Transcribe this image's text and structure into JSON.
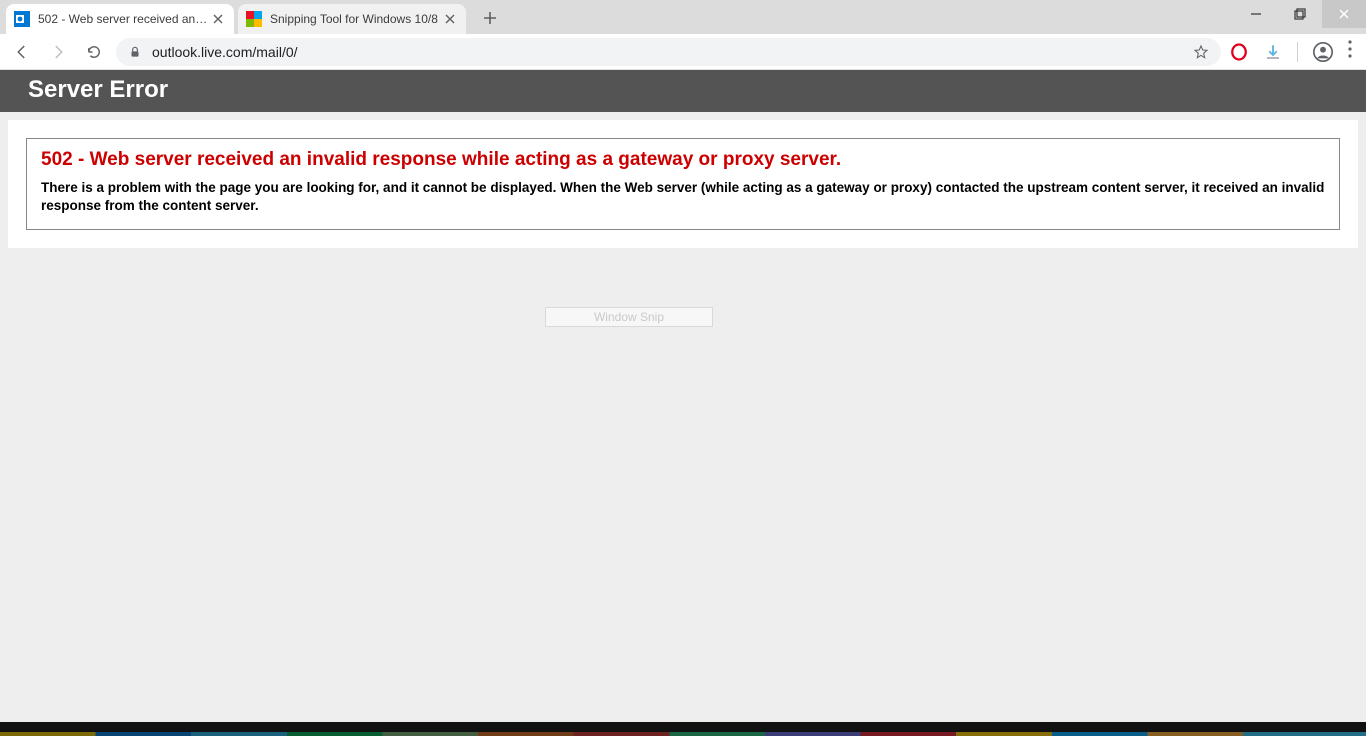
{
  "tabs": [
    {
      "title": "502 - Web server received an inv",
      "favicon": "outlook"
    },
    {
      "title": "Snipping Tool for Windows 10/8",
      "favicon": "multicolor"
    }
  ],
  "address_bar": {
    "url": "outlook.live.com/mail/0/"
  },
  "page": {
    "header": "Server Error",
    "error_title": "502 - Web server received an invalid response while acting as a gateway or proxy server.",
    "error_desc": "There is a problem with the page you are looking for, and it cannot be displayed. When the Web server (while acting as a gateway or proxy) contacted the upstream content server, it received an invalid response from the content server."
  },
  "tooltip": "Window Snip"
}
